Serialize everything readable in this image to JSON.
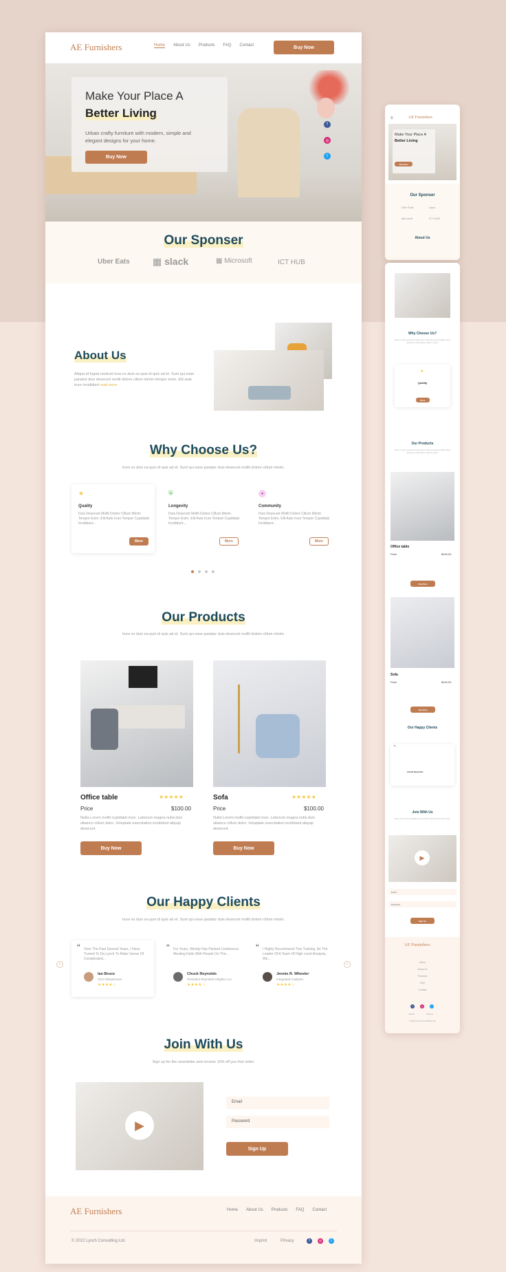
{
  "brand": {
    "logo": "AE Furnishers"
  },
  "nav": {
    "items": [
      "Home",
      "About Us",
      "Products",
      "FAQ",
      "Contact"
    ],
    "buy": "Buy Now"
  },
  "hero": {
    "title1": "Make Your Place A",
    "title2": "Better Living",
    "text": "Urban crafty furniture with modern, simple and elegant designs for your home.",
    "button": "Buy Now"
  },
  "sponsor": {
    "title": "Our Sponser",
    "logos": [
      "Uber Eats",
      "slack",
      "Microsoft",
      "ICT HUB"
    ]
  },
  "about": {
    "title": "About Us",
    "text": "Aliqua id fugiat nostrud irure ex duis ea quis id quis ad et. Sunt qui esse pariatur duis deserunt mollit dolore cillum minim tempor enim. Elit aute irure incididunt",
    "more": "read more"
  },
  "why": {
    "title": "Why Choose Us?",
    "sub": "Irure ex duis ea quis id quis ad et. Sunt qui esse pariatur duis deserunt mollit dolore cillum minim.",
    "cards": [
      {
        "title": "Quality",
        "text": "Duis Deserunt Mollit Dolore Cillum Minim Tempor Enim. Elit Aute Irure Tempor Cupidatat Incididunt...",
        "more": "More"
      },
      {
        "title": "Longevity",
        "text": "Duis Deserunt Mollit Dolore Cillum Minim Tempor Enim. Elit Aute Irure Tempor Cupidatat Incididunt...",
        "more": "More"
      },
      {
        "title": "Community",
        "text": "Duis Deserunt Mollit Dolore Cillum Minim Tempor Enim. Elit Aute Irure Tempor Cupidatat Incididunt...",
        "more": "More"
      }
    ]
  },
  "products": {
    "title": "Our Products",
    "sub": "Irure ex duis ea quis id quis ad et. Sunt qui esse pariatur duis deserunt mollit dolore cillum minim.",
    "items": [
      {
        "name": "Office table",
        "price_label": "Price",
        "price": "$100.00",
        "text": "Nulla Lorem mollit cupidatat irure. Laborum magna nulla duis ullamco cillum dolor. Voluptate exercitation incididunt aliquip deserunt.",
        "button": "Buy Now",
        "stars": "★★★★★"
      },
      {
        "name": "Sofa",
        "price_label": "Price",
        "price": "$100.00",
        "text": "Nulla Lorem mollit cupidatat irure. Laborum magna nulla duis ullamco cillum dolor. Voluptate exercitation incididunt aliquip deserunt.",
        "button": "Buy Now",
        "stars": "★★★★★"
      }
    ]
  },
  "clients": {
    "title": "Our Happy Clients",
    "sub": "Irure ex duis ea quis id quis ad et. Sunt qui esse pariatur duis deserunt mollit dolore cillum minim.",
    "items": [
      {
        "quote": "Over The Past Several Years, I Have Turned To Da Lynch To Make Sense Of Complicated...",
        "name": "Ian Bruce",
        "role": "CEO MeQuiznum",
        "stars": "★★★★☆"
      },
      {
        "quote": "For Years, Wendy Has Packed Conference Meeting Halls With People On The...",
        "name": "Chuck Reynolds",
        "role": "President Reynolds Insights LLC",
        "stars": "★★★★☆"
      },
      {
        "quote": "I Highly Recommend This Training. As The Leader Of A Team Of High Level Analysts, We...",
        "name": "Jennie R. Wheeler",
        "role": "Integrated Analytics",
        "stars": "★★★★☆"
      }
    ]
  },
  "join": {
    "title": "Join With Us",
    "sub": "Sign up for the newsletter and receive 10% off you first order.",
    "email": "Email",
    "password": "Password",
    "button": "Sign Up"
  },
  "footer": {
    "links": [
      "Home",
      "About Us",
      "Products",
      "FAQ",
      "Contact"
    ],
    "copy": "© 2022 Lynch Consulting Ltd.",
    "imprint": "Imprint",
    "privacy": "Privacy"
  },
  "colors": {
    "accent": "#c07c51",
    "heading": "#1d4a5a",
    "highlight": "#fbf0c4"
  }
}
